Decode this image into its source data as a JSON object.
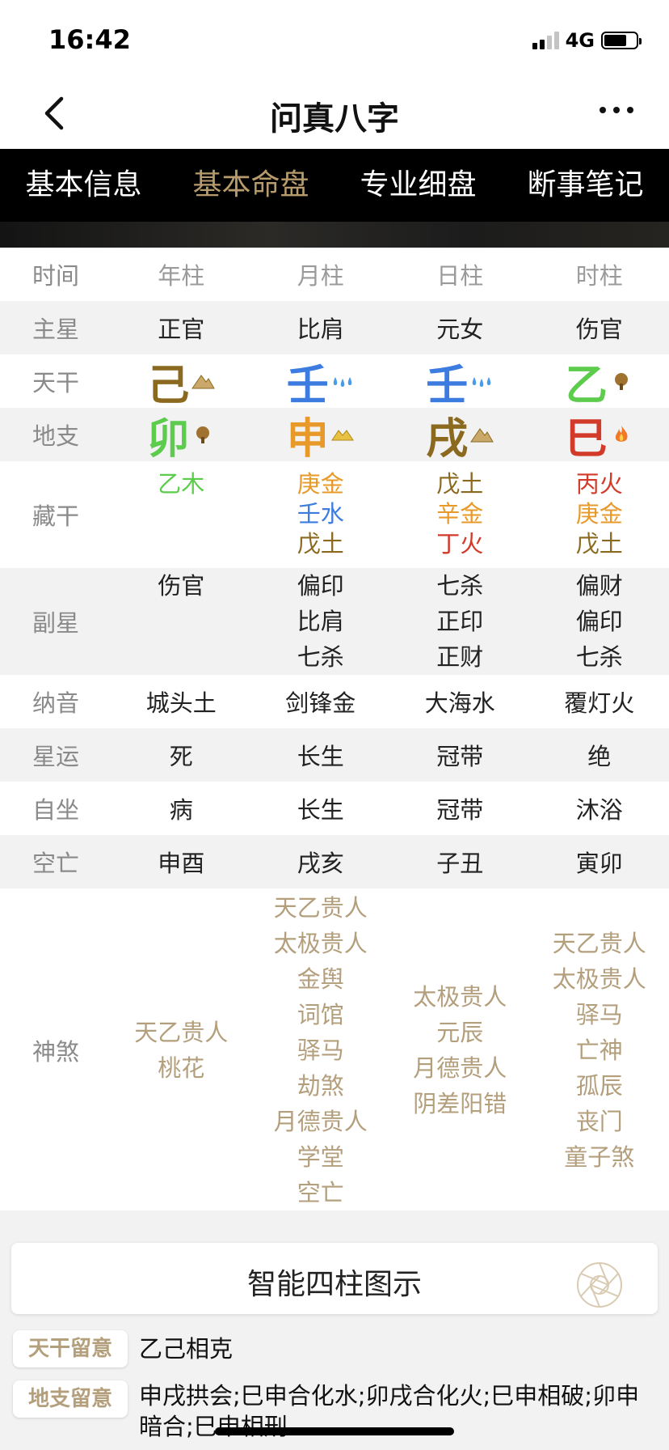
{
  "status": {
    "time": "16:42",
    "network": "4G"
  },
  "nav": {
    "title": "问真八字"
  },
  "tabs": [
    {
      "label": "基本信息",
      "active": false
    },
    {
      "label": "基本命盘",
      "active": true
    },
    {
      "label": "专业细盘",
      "active": false
    },
    {
      "label": "断事笔记",
      "active": false
    }
  ],
  "grid": {
    "header": {
      "label": "时间",
      "cols": [
        "年柱",
        "月柱",
        "日柱",
        "时柱"
      ]
    },
    "zhuxing": {
      "label": "主星",
      "cols": [
        "正官",
        "比肩",
        "元女",
        "伤官"
      ]
    },
    "tiangan": {
      "label": "天干",
      "cols": [
        {
          "char": "己",
          "color": "#8b6a1f",
          "element_icon": "mountain-icon"
        },
        {
          "char": "壬",
          "color": "#3c7be0",
          "element_icon": "water-drops-icon"
        },
        {
          "char": "壬",
          "color": "#3c7be0",
          "element_icon": "water-drops-icon"
        },
        {
          "char": "乙",
          "color": "#5dcc4d",
          "element_icon": "tree-icon"
        }
      ]
    },
    "dizhi": {
      "label": "地支",
      "cols": [
        {
          "char": "卯",
          "color": "#5dcc4d",
          "element_icon": "tree-icon"
        },
        {
          "char": "申",
          "color": "#e79a2a",
          "element_icon": "gold-ingot-icon"
        },
        {
          "char": "戌",
          "color": "#8b6a1f",
          "element_icon": "mountain-icon"
        },
        {
          "char": "巳",
          "color": "#d23a2a",
          "element_icon": "fire-icon"
        }
      ]
    },
    "canggan": {
      "label": "藏干",
      "cols": [
        [
          {
            "text": "乙木",
            "color": "#5dcc4d"
          }
        ],
        [
          {
            "text": "庚金",
            "color": "#e79a2a"
          },
          {
            "text": "壬水",
            "color": "#3c7be0"
          },
          {
            "text": "戊土",
            "color": "#8b6a1f"
          }
        ],
        [
          {
            "text": "戊土",
            "color": "#8b6a1f"
          },
          {
            "text": "辛金",
            "color": "#e79a2a"
          },
          {
            "text": "丁火",
            "color": "#d23a2a"
          }
        ],
        [
          {
            "text": "丙火",
            "color": "#d23a2a"
          },
          {
            "text": "庚金",
            "color": "#e79a2a"
          },
          {
            "text": "戊土",
            "color": "#8b6a1f"
          }
        ]
      ]
    },
    "fuxing": {
      "label": "副星",
      "cols": [
        [
          "伤官"
        ],
        [
          "偏印",
          "比肩",
          "七杀"
        ],
        [
          "七杀",
          "正印",
          "正财"
        ],
        [
          "偏财",
          "偏印",
          "七杀"
        ]
      ]
    },
    "nayin": {
      "label": "纳音",
      "cols": [
        "城头土",
        "剑锋金",
        "大海水",
        "覆灯火"
      ]
    },
    "xingyun": {
      "label": "星运",
      "cols": [
        "死",
        "长生",
        "冠带",
        "绝"
      ]
    },
    "zizuo": {
      "label": "自坐",
      "cols": [
        "病",
        "长生",
        "冠带",
        "沐浴"
      ]
    },
    "kongwang": {
      "label": "空亡",
      "cols": [
        "申酉",
        "戌亥",
        "子丑",
        "寅卯"
      ]
    },
    "shensha": {
      "label": "神煞",
      "cols": [
        [
          "天乙贵人",
          "桃花"
        ],
        [
          "天乙贵人",
          "太极贵人",
          "金舆",
          "词馆",
          "驿马",
          "劫煞",
          "月德贵人",
          "学堂",
          "空亡"
        ],
        [
          "太极贵人",
          "元辰",
          "月德贵人",
          "阴差阳错"
        ],
        [
          "天乙贵人",
          "太极贵人",
          "驿马",
          "亡神",
          "孤辰",
          "丧门",
          "童子煞"
        ]
      ]
    }
  },
  "smart_chart": {
    "label": "智能四柱图示"
  },
  "notes": [
    {
      "badge": "天干留意",
      "value": "乙己相克"
    },
    {
      "badge": "地支留意",
      "value": "申戌拱会;巳申合化水;卯戌合化火;巳申相破;卯申暗合;巳申相刑"
    }
  ]
}
